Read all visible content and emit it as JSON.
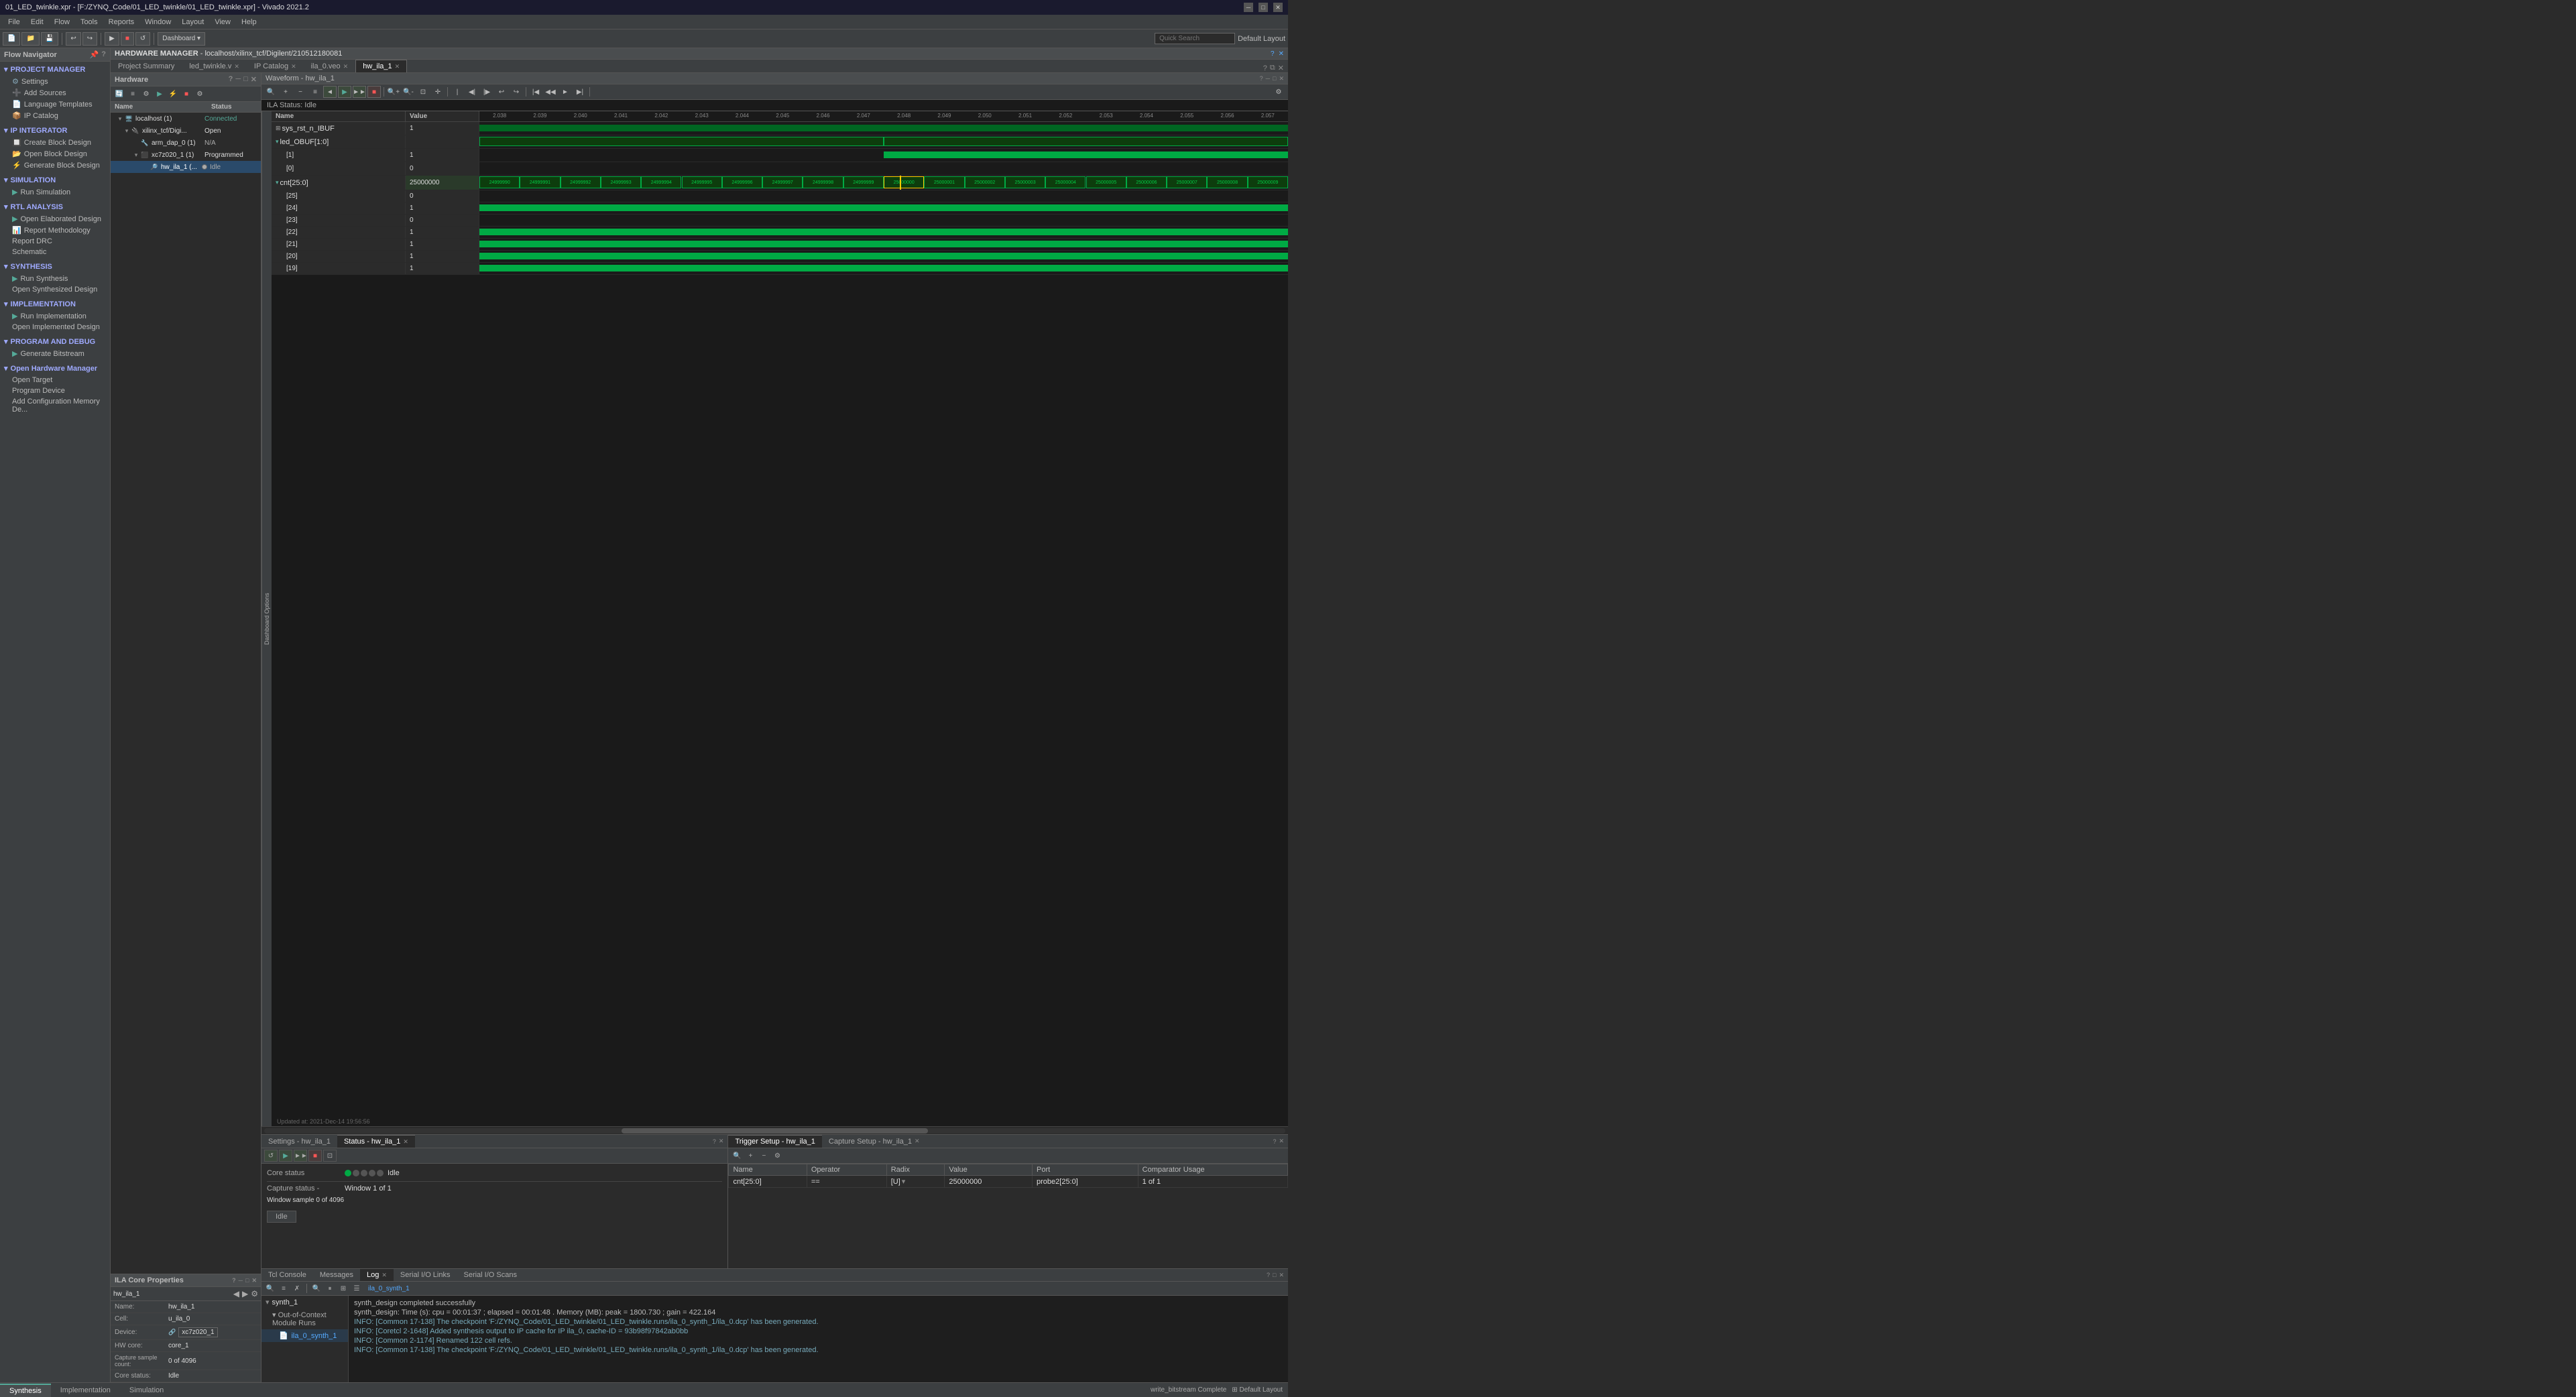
{
  "app": {
    "title": "01_LED_twinkle.xpr - [F:/ZYNQ_Code/01_LED_twinkle/01_LED_twinkle.xpr] - Vivado 2021.2",
    "layout_label": "Default Layout"
  },
  "menu": {
    "items": [
      "File",
      "Edit",
      "Flow",
      "Tools",
      "Reports",
      "Window",
      "Layout",
      "View",
      "Help"
    ]
  },
  "toolbar": {
    "dashboard_label": "Dashboard ▾",
    "search_placeholder": "Quick Search",
    "layout_label": "Default Layout"
  },
  "flow_nav": {
    "title": "Flow Navigator",
    "sections": [
      {
        "name": "PROJECT MANAGER",
        "items": [
          "Settings",
          "Add Sources",
          "Language Templates",
          "IP Catalog"
        ]
      },
      {
        "name": "IP INTEGRATOR",
        "items": [
          "Create Block Design",
          "Open Block Design",
          "Generate Block Design"
        ]
      },
      {
        "name": "SIMULATION",
        "items": [
          "Run Simulation"
        ]
      },
      {
        "name": "RTL ANALYSIS",
        "items": [
          "Open Elaborated Design",
          "Report Methodology"
        ]
      },
      {
        "name": "SYNTHESIS",
        "items": [
          "Run Synthesis",
          "Open Synthesized Design"
        ]
      },
      {
        "name": "IMPLEMENTATION",
        "items": [
          "Run Implementation",
          "Open Implemented Design"
        ]
      },
      {
        "name": "PROGRAM AND DEBUG",
        "items": [
          "Generate Bitstream"
        ]
      },
      {
        "name": "Open Hardware Manager",
        "items": [
          "Open Target",
          "Program Device",
          "Add Configuration Memory De..."
        ]
      }
    ]
  },
  "hw_manager": {
    "title": "HARDWARE MANAGER",
    "server": "localhost/xilinx_tcf/Digilent/210512180081"
  },
  "tabs": {
    "main": [
      {
        "label": "Project Summary",
        "active": false,
        "closable": false
      },
      {
        "label": "led_twinkle.v",
        "active": false,
        "closable": true
      },
      {
        "label": "IP Catalog",
        "active": false,
        "closable": true
      },
      {
        "label": "ila_0.veo",
        "active": false,
        "closable": true
      },
      {
        "label": "hw_ila_1",
        "active": true,
        "closable": true
      }
    ]
  },
  "hardware_tree": {
    "title": "Hardware",
    "columns": [
      "Name",
      "Status"
    ],
    "nodes": [
      {
        "level": 0,
        "name": "localhost (1)",
        "status": "Connected",
        "type": "server",
        "expanded": true
      },
      {
        "level": 1,
        "name": "xilinx_tcf/Digi...",
        "status": "Open",
        "type": "cable",
        "expanded": true
      },
      {
        "level": 2,
        "name": "arm_dap_0 (1)",
        "status": "N/A",
        "type": "arm"
      },
      {
        "level": 2,
        "name": "xc7z020_1 (1)",
        "status": "Programmed",
        "type": "fpga",
        "expanded": true
      },
      {
        "level": 3,
        "name": "hw_ila_1 (...",
        "status": "Idle",
        "type": "ila",
        "selected": true
      }
    ]
  },
  "ila_properties": {
    "title": "ILA Core Properties",
    "device_label": "hw_ila_1",
    "fields": [
      {
        "label": "Name:",
        "value": "hw_ila_1"
      },
      {
        "label": "Cell:",
        "value": "u_ila_0"
      },
      {
        "label": "Device:",
        "value": "xc7z020_1"
      },
      {
        "label": "HW core:",
        "value": "core_1"
      },
      {
        "label": "Capture sample count:",
        "value": "0 of 4096"
      },
      {
        "label": "Core status:",
        "value": "Idle"
      }
    ]
  },
  "waveform": {
    "title": "Waveform - hw_ila_1",
    "ila_status": "ILA Status: Idle",
    "updated_at": "Updated at: 2021-Dec-14 19:56:56",
    "columns": [
      "Name",
      "Value"
    ],
    "signals": [
      {
        "name": "sys_rst_n_IBUF",
        "value": "1",
        "type": "bit",
        "level": 0
      },
      {
        "name": "led_OBUF[1:0]",
        "value": "",
        "type": "bus",
        "level": 0,
        "expanded": true
      },
      {
        "name": "[1]",
        "value": "1",
        "type": "bit",
        "level": 1
      },
      {
        "name": "[0]",
        "value": "0",
        "type": "bit",
        "level": 1
      },
      {
        "name": "cnt[25:0]",
        "value": "25000000",
        "type": "bus",
        "level": 0,
        "expanded": true
      },
      {
        "name": "[25]",
        "value": "0",
        "type": "bit",
        "level": 1
      },
      {
        "name": "[24]",
        "value": "1",
        "type": "bit",
        "level": 1
      },
      {
        "name": "[23]",
        "value": "0",
        "type": "bit",
        "level": 1
      },
      {
        "name": "[22]",
        "value": "1",
        "type": "bit",
        "level": 1
      },
      {
        "name": "[21]",
        "value": "1",
        "type": "bit",
        "level": 1
      },
      {
        "name": "[20]",
        "value": "1",
        "type": "bit",
        "level": 1
      },
      {
        "name": "[19]",
        "value": "1",
        "type": "bit",
        "level": 1
      }
    ],
    "timeline": {
      "markers": [
        "2.038",
        "2.039",
        "2.040",
        "2.041",
        "2.042",
        "2.043",
        "2.044",
        "2.045",
        "2.046",
        "2.047",
        "2.048",
        "2.049",
        "2.050",
        "2.051",
        "2.052",
        "2.053",
        "2.054",
        "2.055",
        "2.056",
        "2.057"
      ]
    },
    "cnt_values": [
      "24999990",
      "24999991",
      "24999992",
      "24999993",
      "24999994",
      "24999995",
      "24999996",
      "24999997",
      "24999998",
      "24999999",
      "25000000",
      "25000001",
      "25000002",
      "25000003",
      "25000004",
      "25000005",
      "25000006",
      "25000007",
      "25000008",
      "25000009"
    ]
  },
  "status_panel": {
    "tabs": [
      "Settings - hw_ila_1",
      "Status - hw_ila_1"
    ],
    "active_tab": "Status - hw_ila_1",
    "core_status": "Idle",
    "capture_status": "Window 1 of 1",
    "window_sample": "Window sample 0 of 4096",
    "idle_label": "Idle"
  },
  "trigger_panel": {
    "tabs": [
      "Trigger Setup - hw_ila_1",
      "Capture Setup - hw_ila_1"
    ],
    "active_tab": "Trigger Setup - hw_ila_1",
    "table": {
      "columns": [
        "Name",
        "Operator",
        "Radix",
        "Value",
        "Port",
        "Comparator Usage"
      ],
      "rows": [
        {
          "name": "cnt[25:0]",
          "operator": "==",
          "radix": "[U]",
          "value": "25000000",
          "port": "probe2[25:0]",
          "comparator": "1 of 1"
        }
      ]
    }
  },
  "log_panel": {
    "tabs": [
      "Tcl Console",
      "Messages",
      "Log",
      "Serial I/O Links",
      "Serial I/O Scans"
    ],
    "active_tab": "Log",
    "synth_label": "ila_0_synth_1",
    "lines": [
      "synth_design completed successfully",
      "synth_design: Time (s): cpu = 00:01:37 ; elapsed = 00:01:48 . Memory (MB): peak = 1800.730 ; gain = 422.164",
      "INFO: [Common 17-138] The checkpoint 'F:/ZYNQ_Code/01_LED_twinkle/01_LED_twinkle.runs/ila_0_synth_1/ila_0.dcp' has been generated.",
      "INFO: [Coretcl 2-1648] Added synthesis output to IP cache for IP ila_0, cache-ID = 93b98f97842ab0bb",
      "INFO: [Common 2-1174] Renamed 122 cell refs.",
      "INFO: [Common 17-138] The checkpoint 'F:/ZYNQ_Code/01_LED_twinkle/01_LED_twinkle.runs/ila_0_synth_1/ila_0.dcp' has been generated."
    ]
  },
  "bottom_tabs": {
    "items": [
      "Synthesis",
      "Implementation",
      "Simulation"
    ],
    "active": "Synthesis"
  },
  "tree": {
    "synth_1": "synth_1",
    "ooc_label": "Out-of-Context Module Runs",
    "ila_run": "ila_0_synth_1"
  }
}
